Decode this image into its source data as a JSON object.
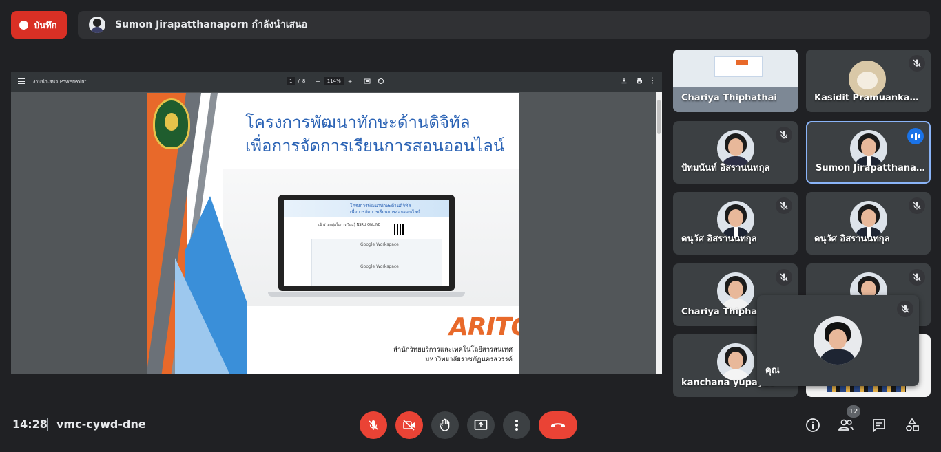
{
  "recording": {
    "label": "บันทึก"
  },
  "presenter": {
    "text": "Sumon Jirapatthanaporn กำลังนำเสนอ"
  },
  "pdf": {
    "title": "งานนำเสนอ PowerPoint",
    "page_current": "1",
    "page_sep": "/",
    "page_total": "8",
    "zoom": "114%",
    "zoom_minus": "−",
    "zoom_plus": "+"
  },
  "slide": {
    "title_line1": "โครงการพัฒนาทักษะด้านดิจิทัล",
    "title_line2": "เพื่อการจัดการเรียนการสอนออนไลน์",
    "inner_title_line1": "โครงการพัฒนาทักษะด้านดิจิทัล",
    "inner_title_line2": "เพื่อการจัดการเรียนการสอนออนไลน์",
    "inner_caption": "เข้าร่วมกลุ่มในการเรียนรู้ NSRU ONLINE",
    "inner_box1": "Google Workspace",
    "inner_box2": "Google Workspace",
    "brand": "ARITC",
    "org_line1": "สำนักวิทยบริการและเทคโนโลยีสารสนเทศ",
    "org_line2": "มหาวิทยาลัยราชภัฏนครสวรรค์"
  },
  "participants": [
    {
      "name": "Chariya Thiphathai",
      "type": "video",
      "muted": false
    },
    {
      "name": "Kasidit Pramuankamon",
      "type": "avatar-dog",
      "muted": true
    },
    {
      "name": "ปัทมนันท์ อิสรานนทกุล",
      "type": "avatar",
      "muted": true
    },
    {
      "name": "Sumon Jirapatthanaporn",
      "type": "avatar-suit",
      "muted": false,
      "speaking": true
    },
    {
      "name": "ดนุวัศ อิสรานนทกุล",
      "type": "avatar-suit",
      "muted": true
    },
    {
      "name": "ดนุวัศ อิสรานนทกุล",
      "type": "avatar-suit",
      "muted": true
    },
    {
      "name": "Chariya Thiphathai",
      "type": "avatar",
      "muted": true
    },
    {
      "name": "",
      "type": "avatar",
      "muted": true
    },
    {
      "name": "kanchana yupayao",
      "type": "avatar",
      "muted": false
    }
  ],
  "self_view": {
    "name": "คุณ"
  },
  "meeting": {
    "time": "14:28",
    "code": "vmc-cywd-dne"
  },
  "people_count": "12",
  "colors": {
    "danger": "#ea4335",
    "accent": "#1a73e8",
    "bg": "#202124",
    "tile": "#3c4043"
  }
}
